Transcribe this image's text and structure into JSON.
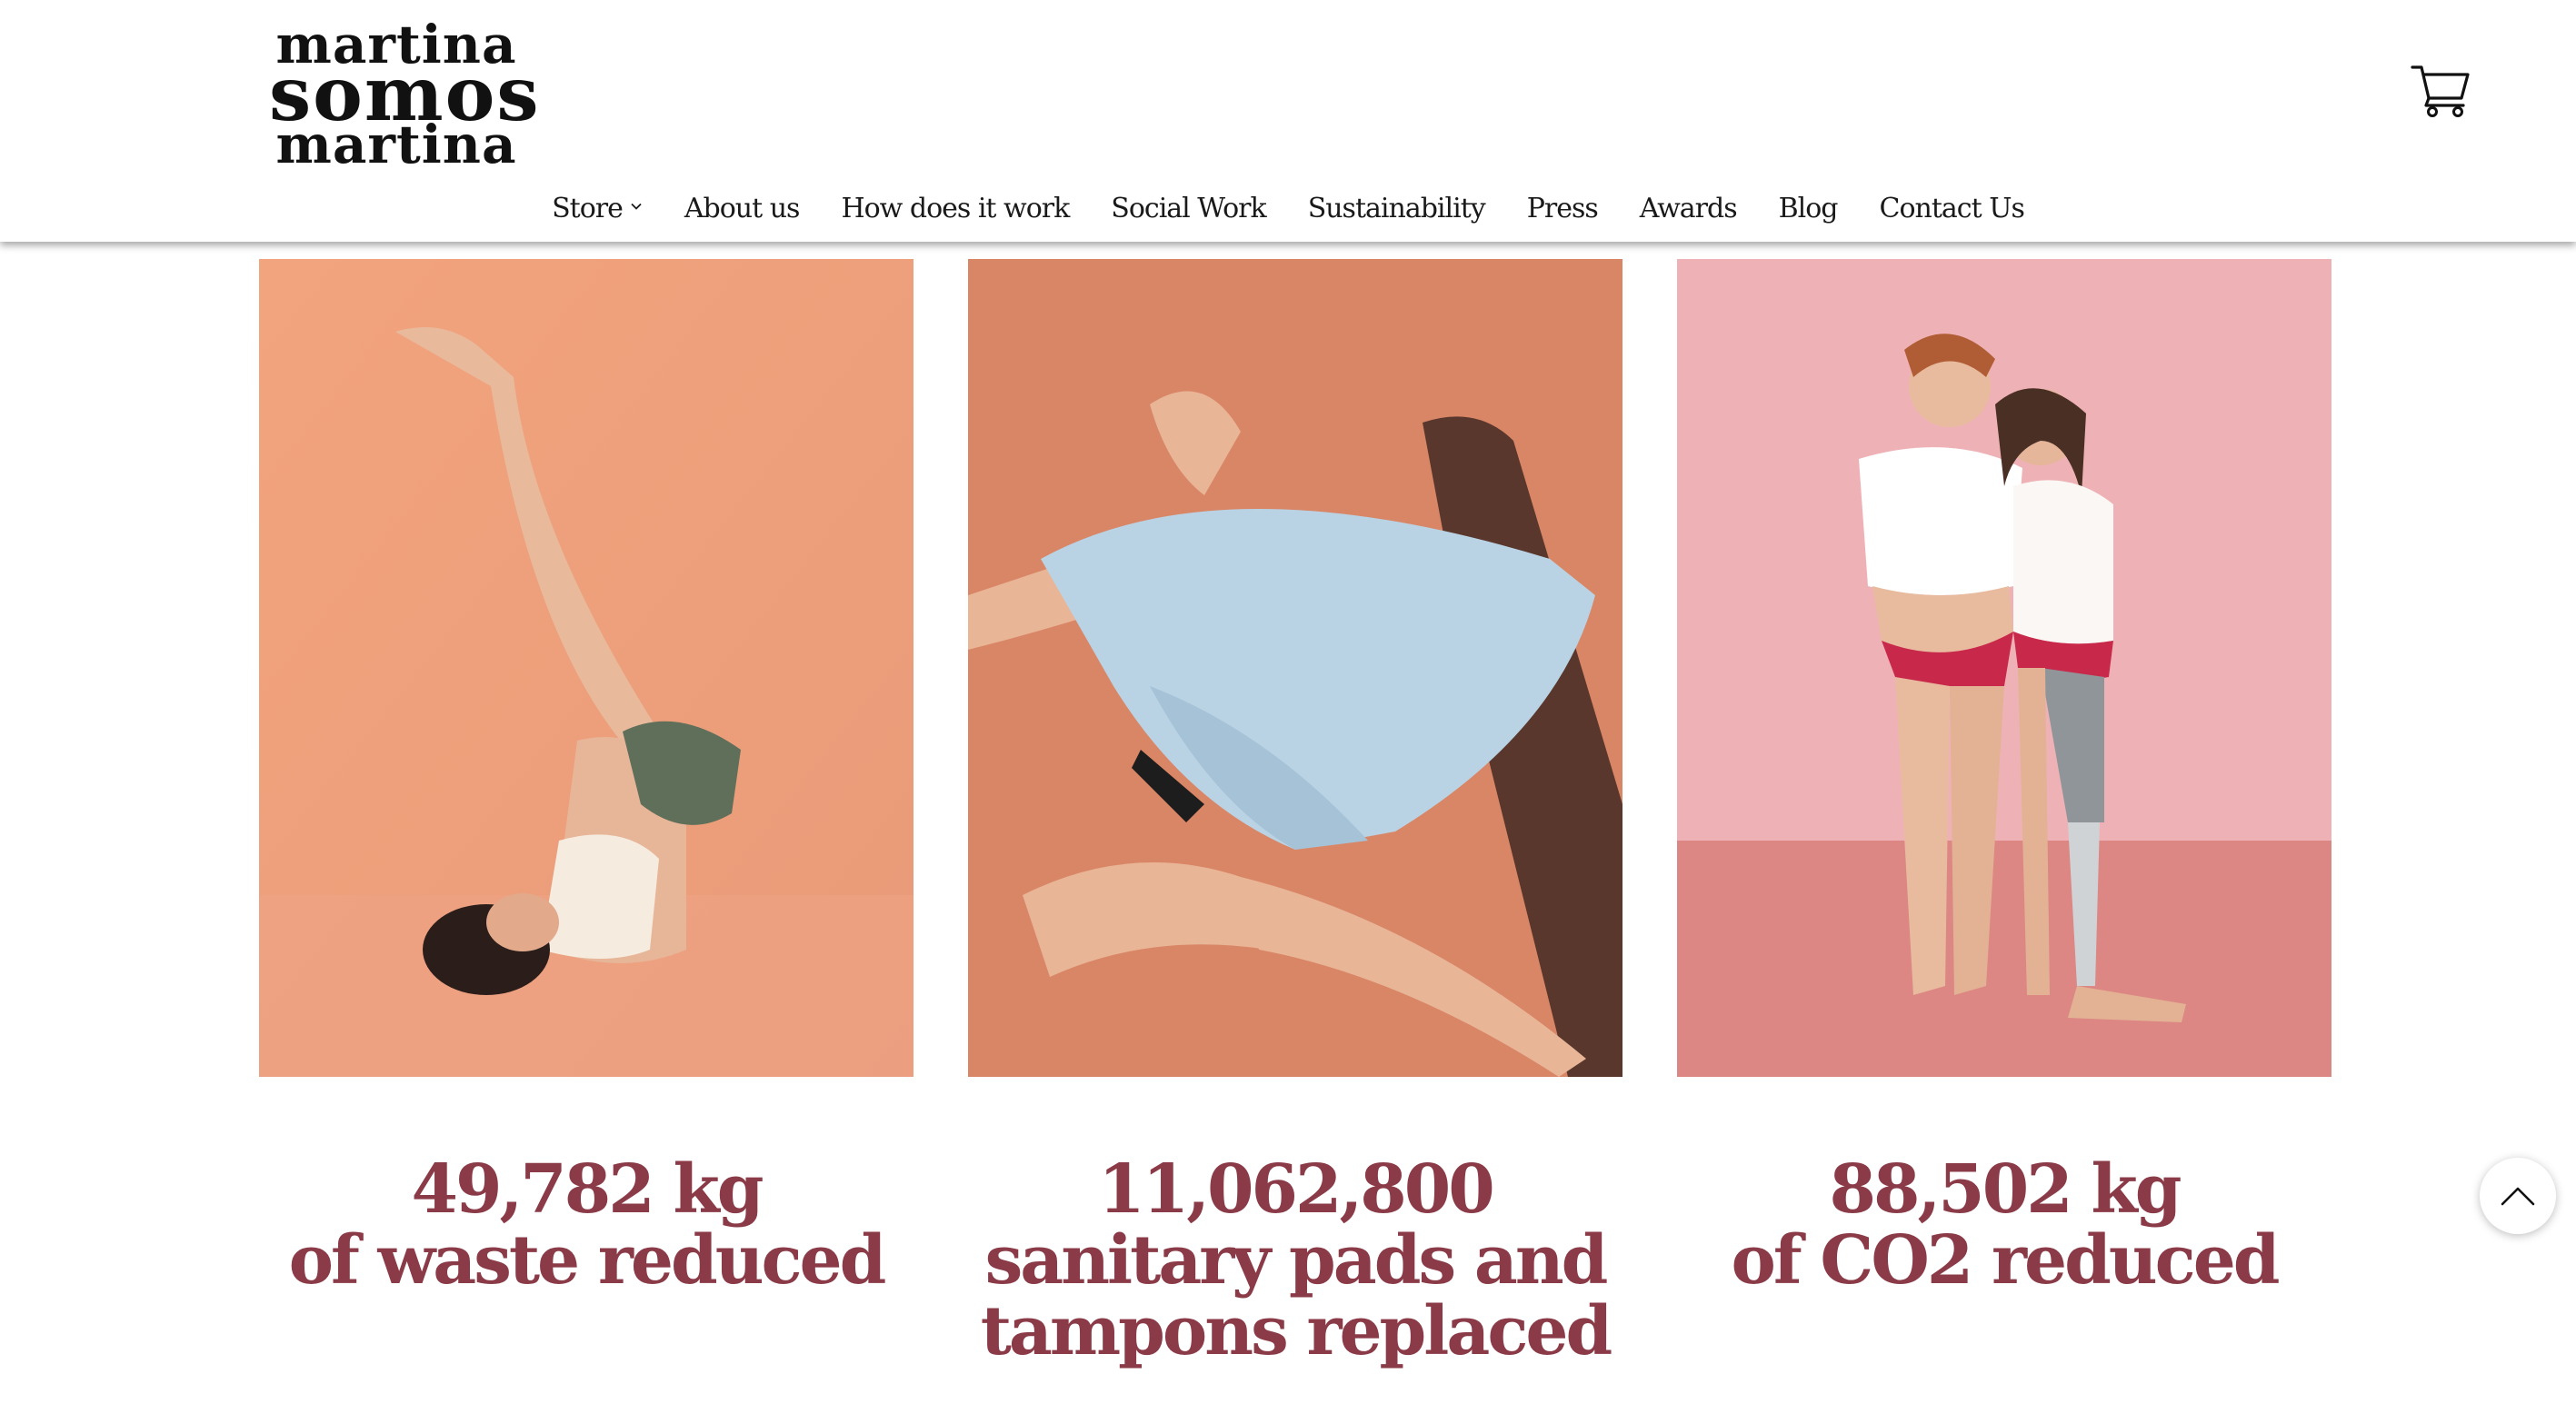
{
  "brand": {
    "logo_top": "martina",
    "logo_middle": "somos",
    "logo_bottom": "martina"
  },
  "header": {
    "cart_icon": "cart-icon"
  },
  "nav": {
    "items": [
      {
        "label": "Store",
        "has_dropdown": true
      },
      {
        "label": "About us"
      },
      {
        "label": "How does it work"
      },
      {
        "label": "Social Work"
      },
      {
        "label": "Sustainability"
      },
      {
        "label": "Press"
      },
      {
        "label": "Awards"
      },
      {
        "label": "Blog"
      },
      {
        "label": "Contact Us"
      }
    ]
  },
  "impact": [
    {
      "line1": "49,782 kg",
      "line2": "of waste reduced"
    },
    {
      "line1": "11,062,800",
      "line2": "sanitary pads and",
      "line3": "tampons replaced"
    },
    {
      "line1": "88,502 kg",
      "line2": "of CO2 reduced"
    }
  ],
  "colors": {
    "stat_text": "#8a3b47",
    "nav_text": "#1a1a1a",
    "photo1_bg": "#efa37f",
    "photo2_bg": "#d9876a",
    "photo3_bg": "#eeb3b5"
  },
  "back_to_top_icon": "chevron-up-icon"
}
